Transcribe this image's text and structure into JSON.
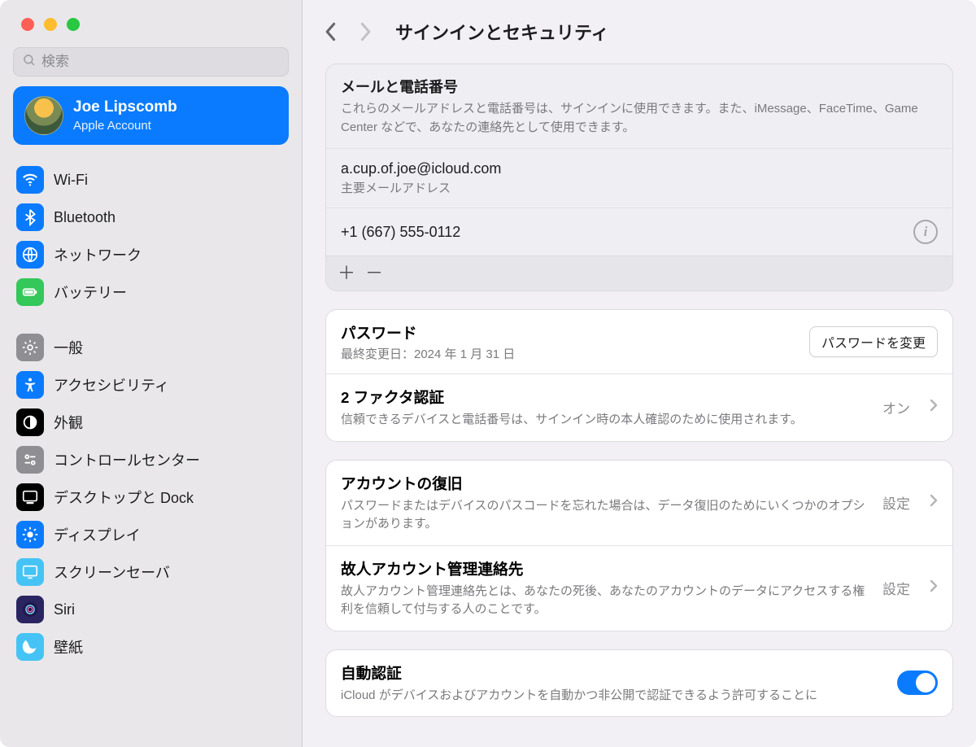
{
  "window": {
    "title": "サインインとセキュリティ"
  },
  "sidebar": {
    "search_placeholder": "検索",
    "account": {
      "name": "Joe Lipscomb",
      "subtitle": "Apple Account"
    },
    "items": [
      {
        "label": "Wi-Fi"
      },
      {
        "label": "Bluetooth"
      },
      {
        "label": "ネットワーク"
      },
      {
        "label": "バッテリー"
      },
      {
        "label": "一般"
      },
      {
        "label": "アクセシビリティ"
      },
      {
        "label": "外観"
      },
      {
        "label": "コントロールセンター"
      },
      {
        "label": "デスクトップと Dock"
      },
      {
        "label": "ディスプレイ"
      },
      {
        "label": "スクリーンセーバ"
      },
      {
        "label": "Siri"
      },
      {
        "label": "壁紙"
      }
    ]
  },
  "section_contacts": {
    "heading": "メールと電話番号",
    "description": "これらのメールアドレスと電話番号は、サインインに使用できます。また、iMessage、FaceTime、Game Center などで、あなたの連絡先として使用できます。",
    "email": "a.cup.of.joe@icloud.com",
    "email_sub": "主要メールアドレス",
    "phone": "+1 (667) 555-0112"
  },
  "section_password": {
    "heading": "パスワード",
    "sub": "最終変更日：2024 年 1 月 31 日",
    "button": "パスワードを変更"
  },
  "section_twofactor": {
    "heading": "2 ファクタ認証",
    "desc": "信頼できるデバイスと電話番号は、サインイン時の本人確認のために使用されます。",
    "status": "オン"
  },
  "section_recovery": {
    "heading": "アカウントの復旧",
    "desc": "パスワードまたはデバイスのパスコードを忘れた場合は、データ復旧のためにいくつかのオプションがあります。",
    "status": "設定"
  },
  "section_legacy": {
    "heading": "故人アカウント管理連絡先",
    "desc": "故人アカウント管理連絡先とは、あなたの死後、あなたのアカウントのデータにアクセスする権利を信頼して付与する人のことです。",
    "status": "設定"
  },
  "section_autoverify": {
    "heading": "自動認証",
    "desc": "iCloud がデバイスおよびアカウントを自動かつ非公開で認証できるよう許可することに"
  }
}
